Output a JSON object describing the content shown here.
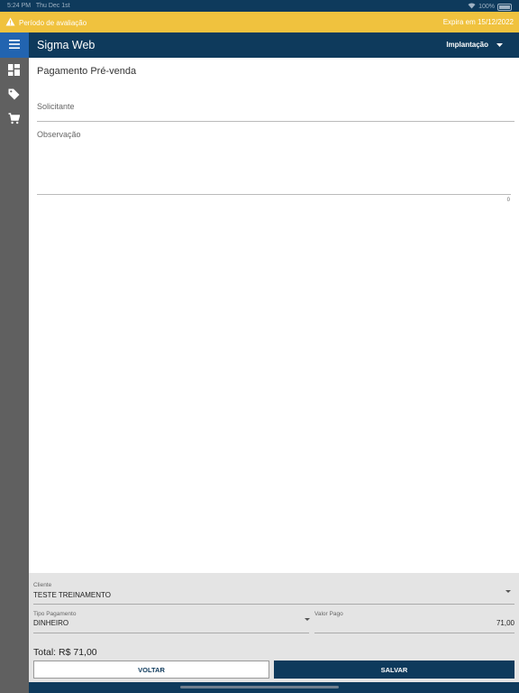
{
  "statusbar": {
    "time": "5:24 PM",
    "date": "Thu Dec 1st",
    "battery": "100%"
  },
  "warning": {
    "message": "Período de avaliação",
    "expiry": "Expira em 15/12/2022"
  },
  "appbar": {
    "title": "Sigma Web",
    "environment": "Implantação"
  },
  "sidebar": {
    "items": [
      {
        "icon": "dashboard-icon"
      },
      {
        "icon": "tag-icon"
      },
      {
        "icon": "cart-icon"
      }
    ]
  },
  "form": {
    "title": "Pagamento Pré-venda",
    "solicitante_label": "Solicitante",
    "observacao_label": "Observação",
    "observacao_counter": "0"
  },
  "summary": {
    "cliente_label": "Cliente",
    "cliente_value": "TESTE TREINAMENTO",
    "tipo_pagamento_label": "Tipo Pagamento",
    "tipo_pagamento_value": "DINHEIRO",
    "valor_pago_label": "Valor Pago",
    "valor_pago_value": "71,00",
    "total": "Total: R$ 71,00",
    "back_label": "VOLTAR",
    "save_label": "SALVAR"
  },
  "colors": {
    "primary": "#0e3a5c",
    "warning": "#f0c23e",
    "accent": "#2264b0",
    "sidebar": "#606060"
  }
}
